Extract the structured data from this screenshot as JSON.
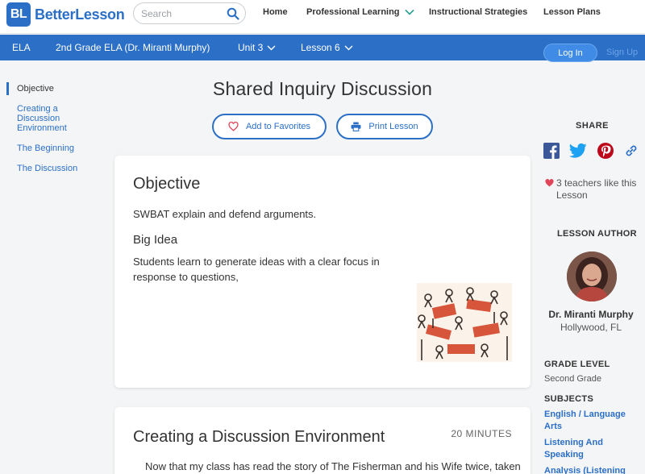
{
  "brand": {
    "badge": "BL",
    "name": "BetterLesson"
  },
  "search": {
    "placeholder": "Search",
    "value": ""
  },
  "nav": {
    "home": "Home",
    "professional_learning": "Professional Learning",
    "instructional_strategies": "Instructional Strategies",
    "lesson_plans": "Lesson Plans"
  },
  "breadcrumb": {
    "subject": "ELA",
    "course": "2nd Grade ELA (Dr. Miranti Murphy)",
    "unit": "Unit 3",
    "lesson": "Lesson 6"
  },
  "auth": {
    "login": "Log In",
    "signup": "Sign Up"
  },
  "toc": [
    {
      "label": "Objective"
    },
    {
      "label": "Creating a Discussion Environment"
    },
    {
      "label": "The Beginning"
    },
    {
      "label": "The Discussion"
    }
  ],
  "lesson": {
    "title": "Shared Inquiry Discussion",
    "add_favorites": "Add to Favorites",
    "print": "Print Lesson"
  },
  "objective": {
    "heading": "Objective",
    "text": "SWBAT explain and defend arguments.",
    "big_idea_heading": "Big Idea",
    "big_idea_text": "Students learn to generate ideas with a clear focus in response to questions,"
  },
  "section2": {
    "heading": "Creating a Discussion Environment",
    "minutes": "20 MINUTES",
    "text": "Now that my class has read the story of The Fisherman and his Wife twice, taken"
  },
  "sidebar": {
    "share": "SHARE",
    "likes": "3 teachers like this Lesson",
    "author_heading": "LESSON AUTHOR",
    "author_name": "Dr. Miranti Murphy",
    "author_location": "Hollywood, FL",
    "grade_heading": "GRADE LEVEL",
    "grade_value": "Second Grade",
    "subjects_heading": "SUBJECTS",
    "subjects": [
      "English / Language Arts",
      "Listening And Speaking",
      "Analysis (Listening And"
    ]
  },
  "colors": {
    "brand_blue": "#2b6fc7",
    "facebook": "#3b5998",
    "twitter": "#1da1f2",
    "pinterest": "#bd081c",
    "heart": "#e0455a"
  }
}
